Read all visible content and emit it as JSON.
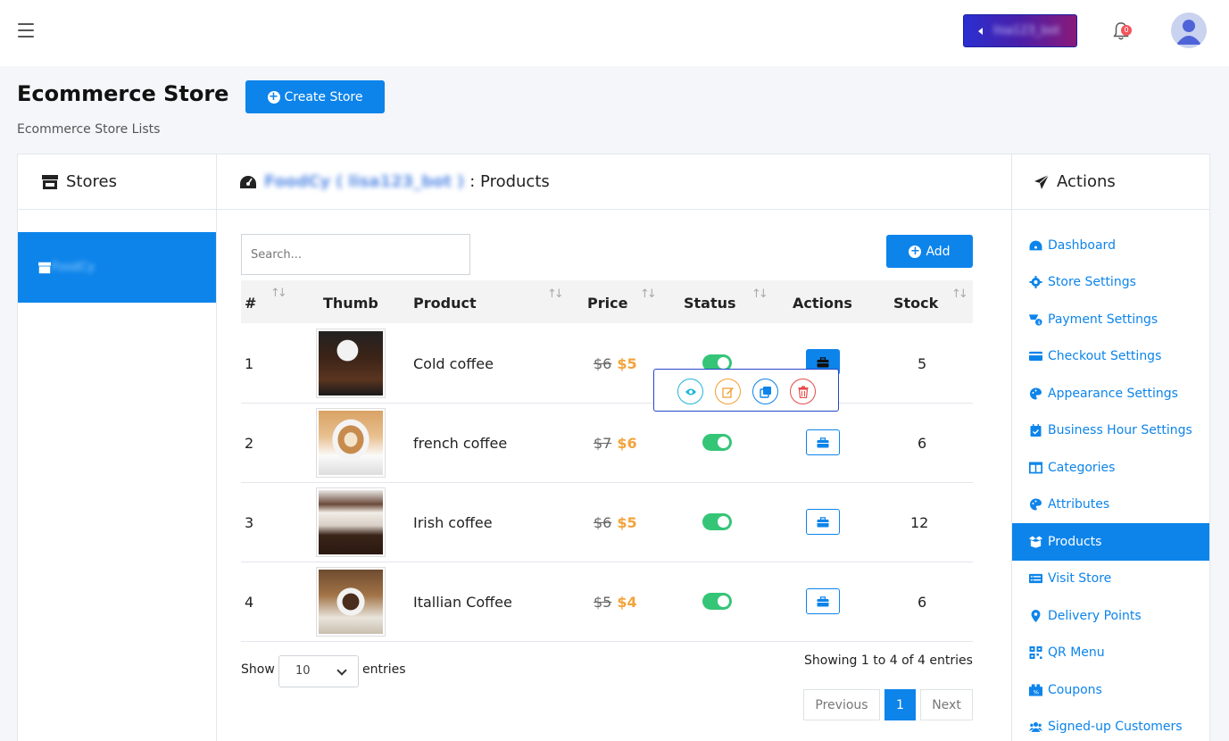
{
  "topbar": {
    "bot_label": "lisa123_bot",
    "notification_count": "0"
  },
  "header": {
    "title": "Ecommerce Store",
    "create_button": "Create Store",
    "subtitle": "Ecommerce Store Lists"
  },
  "stores": {
    "title": "Stores",
    "items": [
      {
        "label": "FoodCy"
      }
    ]
  },
  "products": {
    "store_name": "FoodCy",
    "bot_name": "lisa123_bot",
    "title_suffix": ": Products",
    "search_placeholder": "Search...",
    "add_button": "Add",
    "columns": [
      "#",
      "Thumb",
      "Product",
      "Price",
      "Status",
      "Actions",
      "Stock"
    ],
    "rows": [
      {
        "index": "1",
        "name": "Cold coffee",
        "old_price": "$6",
        "new_price": "$5",
        "stock": "5",
        "enabled": true
      },
      {
        "index": "2",
        "name": "french coffee",
        "old_price": "$7",
        "new_price": "$6",
        "stock": "6",
        "enabled": true
      },
      {
        "index": "3",
        "name": "Irish coffee",
        "old_price": "$6",
        "new_price": "$5",
        "stock": "12",
        "enabled": true
      },
      {
        "index": "4",
        "name": "Itallian Coffee",
        "old_price": "$5",
        "new_price": "$4",
        "stock": "6",
        "enabled": true
      }
    ],
    "page_length_label_before": "Show",
    "page_length": "10",
    "page_length_label_after": "entries",
    "info": "Showing 1 to 4 of 4 entries",
    "pagination": {
      "previous": "Previous",
      "current": "1",
      "next": "Next"
    }
  },
  "actions": {
    "title": "Actions",
    "items": [
      {
        "label": "Dashboard",
        "icon": "dashboard-icon"
      },
      {
        "label": "Store Settings",
        "icon": "gear-icon"
      },
      {
        "label": "Payment Settings",
        "icon": "payment-icon"
      },
      {
        "label": "Checkout Settings",
        "icon": "card-icon"
      },
      {
        "label": "Appearance Settings",
        "icon": "palette-icon"
      },
      {
        "label": "Business Hour Settings",
        "icon": "calendar-icon"
      },
      {
        "label": "Categories",
        "icon": "columns-icon"
      },
      {
        "label": "Attributes",
        "icon": "palette-icon"
      },
      {
        "label": "Products",
        "icon": "box-icon",
        "active": true
      },
      {
        "label": "Visit Store",
        "icon": "list-icon"
      },
      {
        "label": "Delivery Points",
        "icon": "map-pin-icon"
      },
      {
        "label": "QR Menu",
        "icon": "qr-icon"
      },
      {
        "label": "Coupons",
        "icon": "ticket-icon"
      },
      {
        "label": "Signed-up Customers",
        "icon": "users-icon"
      }
    ]
  },
  "colors": {
    "primary": "#0d84ea",
    "price_new": "#f3a33b",
    "toggle_on": "#35c577",
    "delete": "#e54b4b",
    "edit": "#f0a035",
    "view": "#1fb5d8"
  }
}
